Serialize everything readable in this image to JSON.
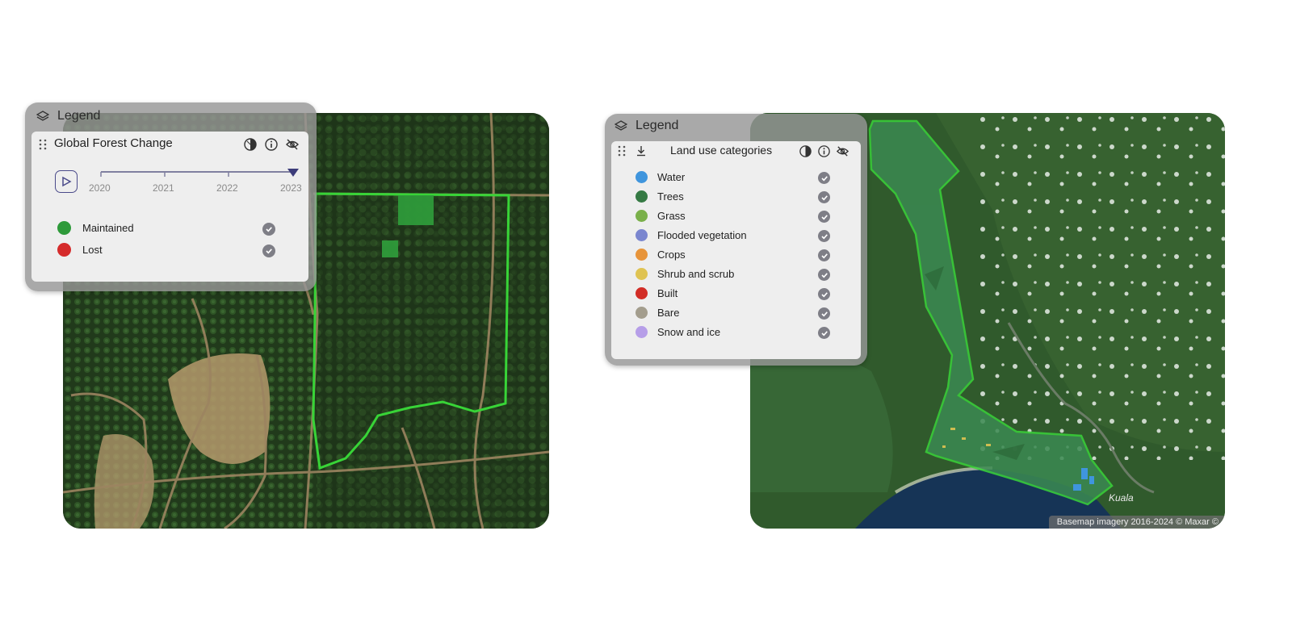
{
  "left_panel": {
    "legend_title": "Legend",
    "layer_title": "Global Forest Change",
    "timeline": {
      "years": [
        "2020",
        "2021",
        "2022",
        "2023"
      ],
      "current": "2023"
    },
    "items": [
      {
        "label": "Maintained",
        "color": "#2e9a3a"
      },
      {
        "label": "Lost",
        "color": "#d52b2b"
      }
    ]
  },
  "right_panel": {
    "legend_title": "Legend",
    "layer_title": "Land use categories",
    "items": [
      {
        "label": "Water",
        "color": "#3f95dd"
      },
      {
        "label": "Trees",
        "color": "#357a44"
      },
      {
        "label": "Grass",
        "color": "#7ab04a"
      },
      {
        "label": "Flooded vegetation",
        "color": "#7a86cf"
      },
      {
        "label": "Crops",
        "color": "#e7943a"
      },
      {
        "label": "Shrub and scrub",
        "color": "#dfc352"
      },
      {
        "label": "Built",
        "color": "#d22d26"
      },
      {
        "label": "Bare",
        "color": "#a39d8d"
      },
      {
        "label": "Snow and ice",
        "color": "#b69ee8"
      }
    ]
  },
  "right_map": {
    "place_label": "Kuala",
    "attribution": "Basemap imagery 2016-2024 © Maxar ©"
  },
  "icons": [
    "layers-icon",
    "drag-handle-icon",
    "opacity-icon",
    "info-icon",
    "eye-off-icon",
    "play-icon",
    "check-icon",
    "download-icon"
  ]
}
